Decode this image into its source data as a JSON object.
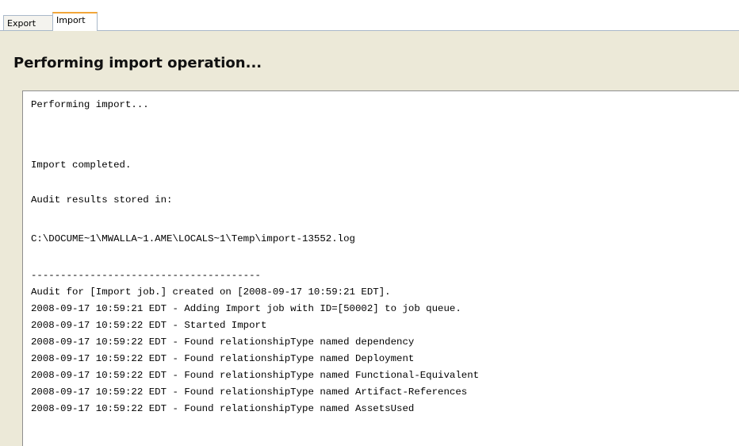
{
  "tabs": [
    {
      "label": "Export",
      "active": false
    },
    {
      "label": "Import",
      "active": true
    }
  ],
  "panel": {
    "heading": "Performing import operation..."
  },
  "log": {
    "status_lines": [
      "Performing import...",
      "Import completed.",
      "Audit results stored in:",
      "C:\\DOCUME~1\\MWALLA~1.AME\\LOCALS~1\\Temp\\import-13552.log"
    ],
    "separator": "---------------------------------------",
    "audit_lines": [
      "Audit for [Import job.] created on [2008-09-17 10:59:21 EDT].",
      "2008-09-17 10:59:21 EDT - Adding Import job with ID=[50002] to job queue.",
      "2008-09-17 10:59:22 EDT - Started Import",
      "2008-09-17 10:59:22 EDT - Found relationshipType named dependency",
      "2008-09-17 10:59:22 EDT - Found relationshipType named Deployment",
      "2008-09-17 10:59:22 EDT - Found relationshipType named Functional-Equivalent",
      "2008-09-17 10:59:22 EDT - Found relationshipType named Artifact-References",
      "2008-09-17 10:59:22 EDT - Found relationshipType named AssetsUsed"
    ]
  },
  "colors": {
    "panel_bg": "#ece9d8",
    "active_tab_accent": "#f2a63a",
    "tab_border": "#a9b8c9"
  }
}
